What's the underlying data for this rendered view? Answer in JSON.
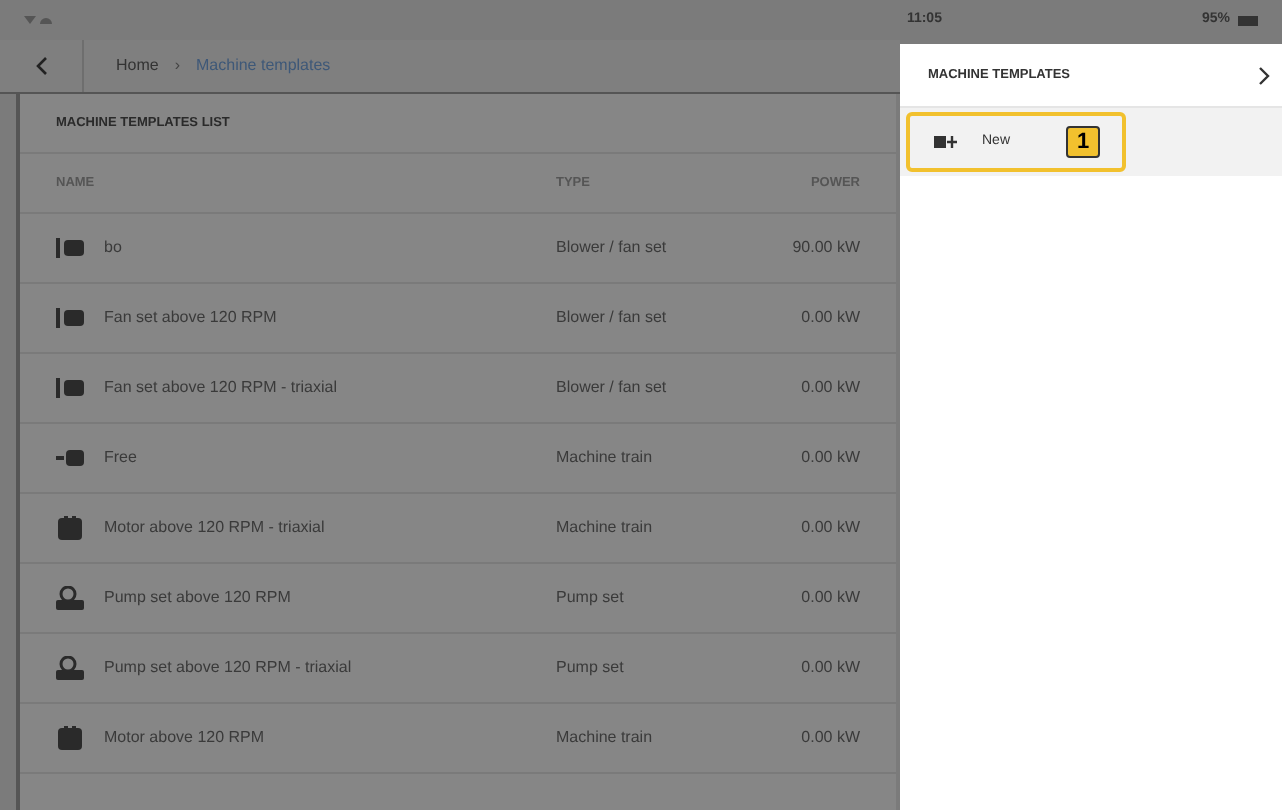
{
  "status_bar": {
    "time": "11:05",
    "battery": "95%"
  },
  "breadcrumb": {
    "items": [
      "Home",
      "Machine templates"
    ],
    "separator": "›"
  },
  "list": {
    "title": "MACHINE TEMPLATES LIST",
    "columns": [
      "NAME",
      "TYPE",
      "POWER"
    ],
    "rows": [
      {
        "kind": "fan",
        "name": "bo",
        "type": "Blower / fan set",
        "power": "90.00 kW"
      },
      {
        "kind": "fan",
        "name": "Fan set above 120 RPM",
        "type": "Blower / fan set",
        "power": "0.00 kW"
      },
      {
        "kind": "fan",
        "name": "Fan set above 120 RPM - triaxial",
        "type": "Blower / fan set",
        "power": "0.00 kW"
      },
      {
        "kind": "train",
        "name": "Free",
        "type": "Machine train",
        "power": "0.00 kW"
      },
      {
        "kind": "motor",
        "name": "Motor above 120 RPM - triaxial",
        "type": "Machine train",
        "power": "0.00 kW"
      },
      {
        "kind": "pump",
        "name": "Pump set above 120 RPM",
        "type": "Pump set",
        "power": "0.00 kW"
      },
      {
        "kind": "pump",
        "name": "Pump set above 120 RPM - triaxial",
        "type": "Pump set",
        "power": "0.00 kW"
      },
      {
        "kind": "motor",
        "name": "Motor above 120 RPM",
        "type": "Machine train",
        "power": "0.00 kW"
      }
    ]
  },
  "side_panel": {
    "title": "MACHINE TEMPLATES",
    "items": [
      {
        "label": "New",
        "highlighted": true,
        "callout": "1"
      }
    ]
  }
}
